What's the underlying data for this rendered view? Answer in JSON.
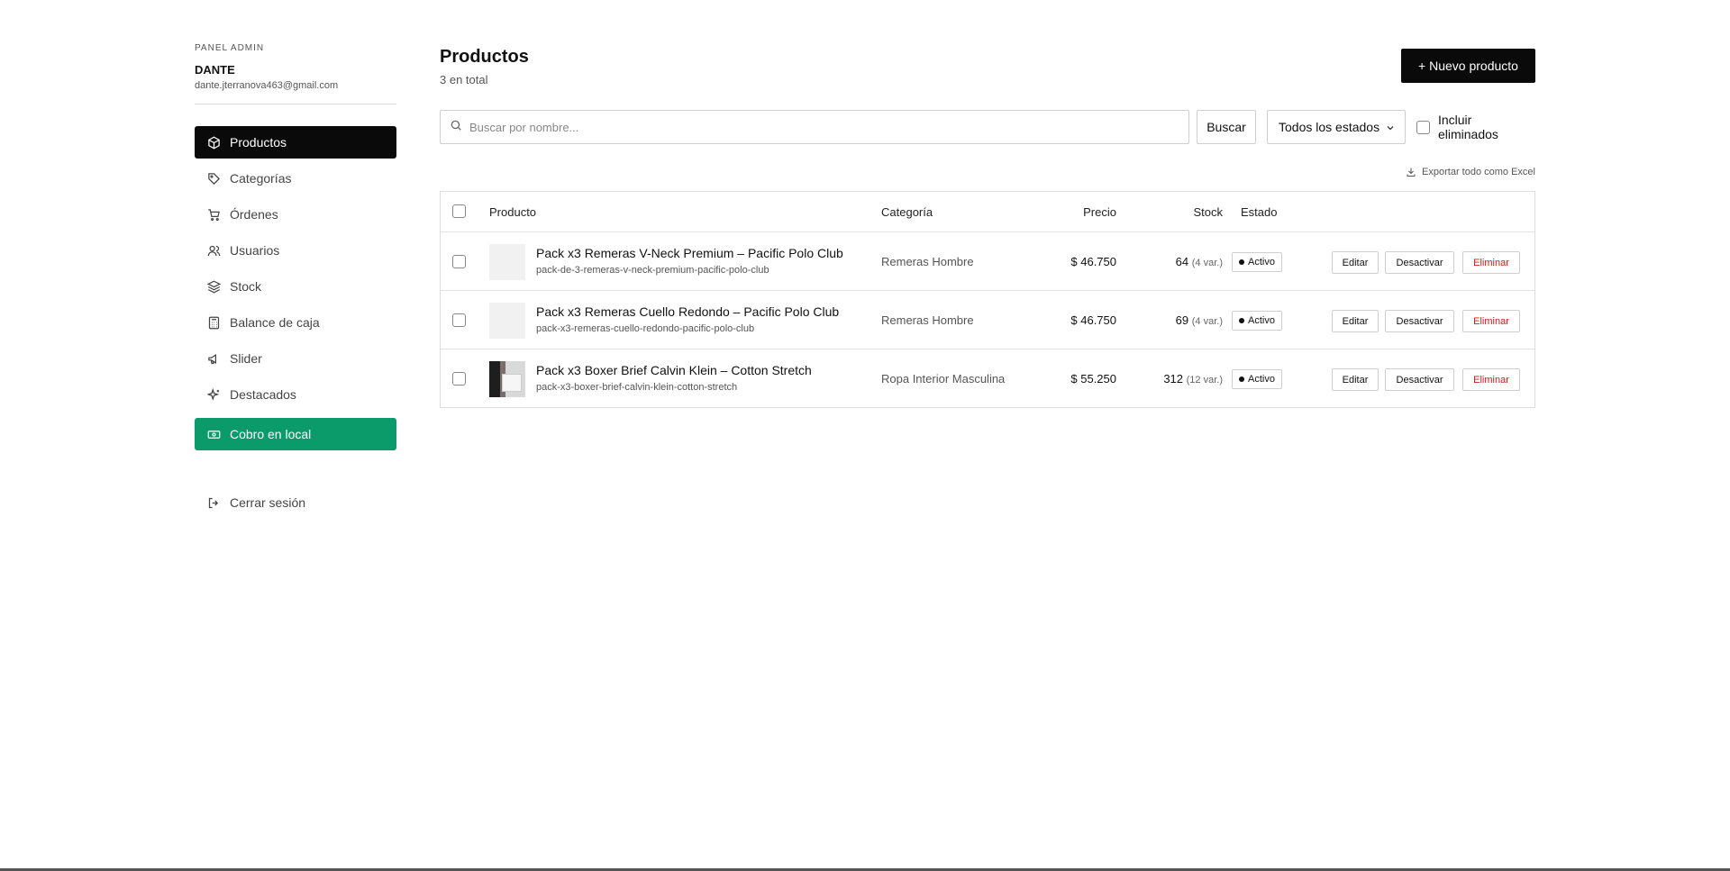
{
  "sidebar": {
    "kicker": "PANEL ADMIN",
    "user_name": "DANTE",
    "user_email": "dante.jterranova463@gmail.com",
    "items": [
      {
        "label": "Productos",
        "icon": "box-icon",
        "active": true
      },
      {
        "label": "Categorías",
        "icon": "tag-icon"
      },
      {
        "label": "Órdenes",
        "icon": "cart-icon"
      },
      {
        "label": "Usuarios",
        "icon": "users-icon"
      },
      {
        "label": "Stock",
        "icon": "layers-icon"
      },
      {
        "label": "Balance de caja",
        "icon": "calculator-icon"
      },
      {
        "label": "Slider",
        "icon": "megaphone-icon"
      },
      {
        "label": "Destacados",
        "icon": "sparkles-icon"
      },
      {
        "label": "Cobro en local",
        "icon": "cash-icon",
        "accent": "#0b9a6a"
      }
    ],
    "logout_label": "Cerrar sesión"
  },
  "header": {
    "title": "Productos",
    "subtitle": "3 en total",
    "new_button": "+ Nuevo producto"
  },
  "filters": {
    "search_placeholder": "Buscar por nombre...",
    "search_button": "Buscar",
    "status_select": "Todos los estados",
    "include_deleted": "Incluir eliminados"
  },
  "export_label": "Exportar todo como Excel",
  "table": {
    "columns": {
      "product": "Producto",
      "category": "Categoría",
      "price": "Precio",
      "stock": "Stock",
      "status": "Estado"
    },
    "rows": [
      {
        "name": "Pack x3 Remeras V-Neck Premium – Pacific Polo Club",
        "slug": "pack-de-3-remeras-v-neck-premium-pacific-polo-club",
        "category": "Remeras Hombre",
        "price": "$ 46.750",
        "stock": "64",
        "variants": "(4 var.)",
        "status": "Activo",
        "edit": "Editar",
        "deactivate": "Desactivar",
        "delete": "Eliminar"
      },
      {
        "name": "Pack x3 Remeras Cuello Redondo – Pacific Polo Club",
        "slug": "pack-x3-remeras-cuello-redondo-pacific-polo-club",
        "category": "Remeras Hombre",
        "price": "$ 46.750",
        "stock": "69",
        "variants": "(4 var.)",
        "status": "Activo",
        "edit": "Editar",
        "deactivate": "Desactivar",
        "delete": "Eliminar"
      },
      {
        "name": "Pack x3 Boxer Brief Calvin Klein – Cotton Stretch",
        "slug": "pack-x3-boxer-brief-calvin-klein-cotton-stretch",
        "category": "Ropa Interior Masculina",
        "price": "$ 55.250",
        "stock": "312",
        "variants": "(12 var.)",
        "status": "Activo",
        "edit": "Editar",
        "deactivate": "Desactivar",
        "delete": "Eliminar"
      }
    ]
  }
}
